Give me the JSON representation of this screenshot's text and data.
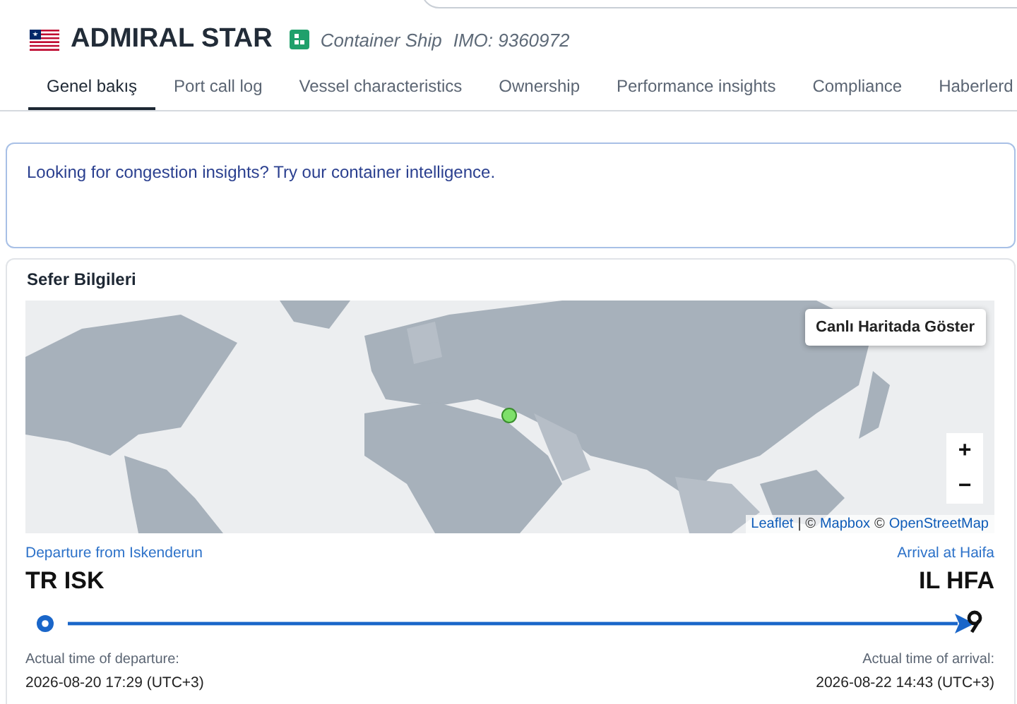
{
  "vessel": {
    "name": "ADMIRAL STAR",
    "type": "Container Ship",
    "imo": "IMO: 9360972"
  },
  "tabs": [
    {
      "label": "Genel bakış",
      "selected": true
    },
    {
      "label": "Port call log",
      "selected": false
    },
    {
      "label": "Vessel characteristics",
      "selected": false
    },
    {
      "label": "Ownership",
      "selected": false
    },
    {
      "label": "Performance insights",
      "selected": false
    },
    {
      "label": "Compliance",
      "selected": false
    },
    {
      "label": "Haberlerd",
      "selected": false
    }
  ],
  "banner": {
    "text": "Looking for congestion insights? Try our container intelligence."
  },
  "voyage": {
    "title": "Sefer Bilgileri",
    "map": {
      "kind": "picture",
      "live_button": "Canlı Haritada Göster",
      "zoom_in": "+",
      "zoom_out": "−",
      "attribution": [
        {
          "kind": "link",
          "text": "Leaflet"
        },
        {
          "kind": "text",
          "text": "| ©"
        },
        {
          "kind": "link",
          "text": "Mapbox"
        },
        {
          "kind": "text",
          "text": "©"
        },
        {
          "kind": "link",
          "text": "OpenStreetMap"
        }
      ]
    },
    "departure": {
      "label": "Departure from Iskenderun",
      "code": "TR ISK",
      "time_label": "Actual time of departure:",
      "time": "2026-08-20 17:29 (UTC+3)"
    },
    "arrival": {
      "label": "Arrival at Haifa",
      "code": "IL HFA",
      "time_label": "Actual time of arrival:",
      "time": "2026-08-22 14:43 (UTC+3)"
    }
  }
}
